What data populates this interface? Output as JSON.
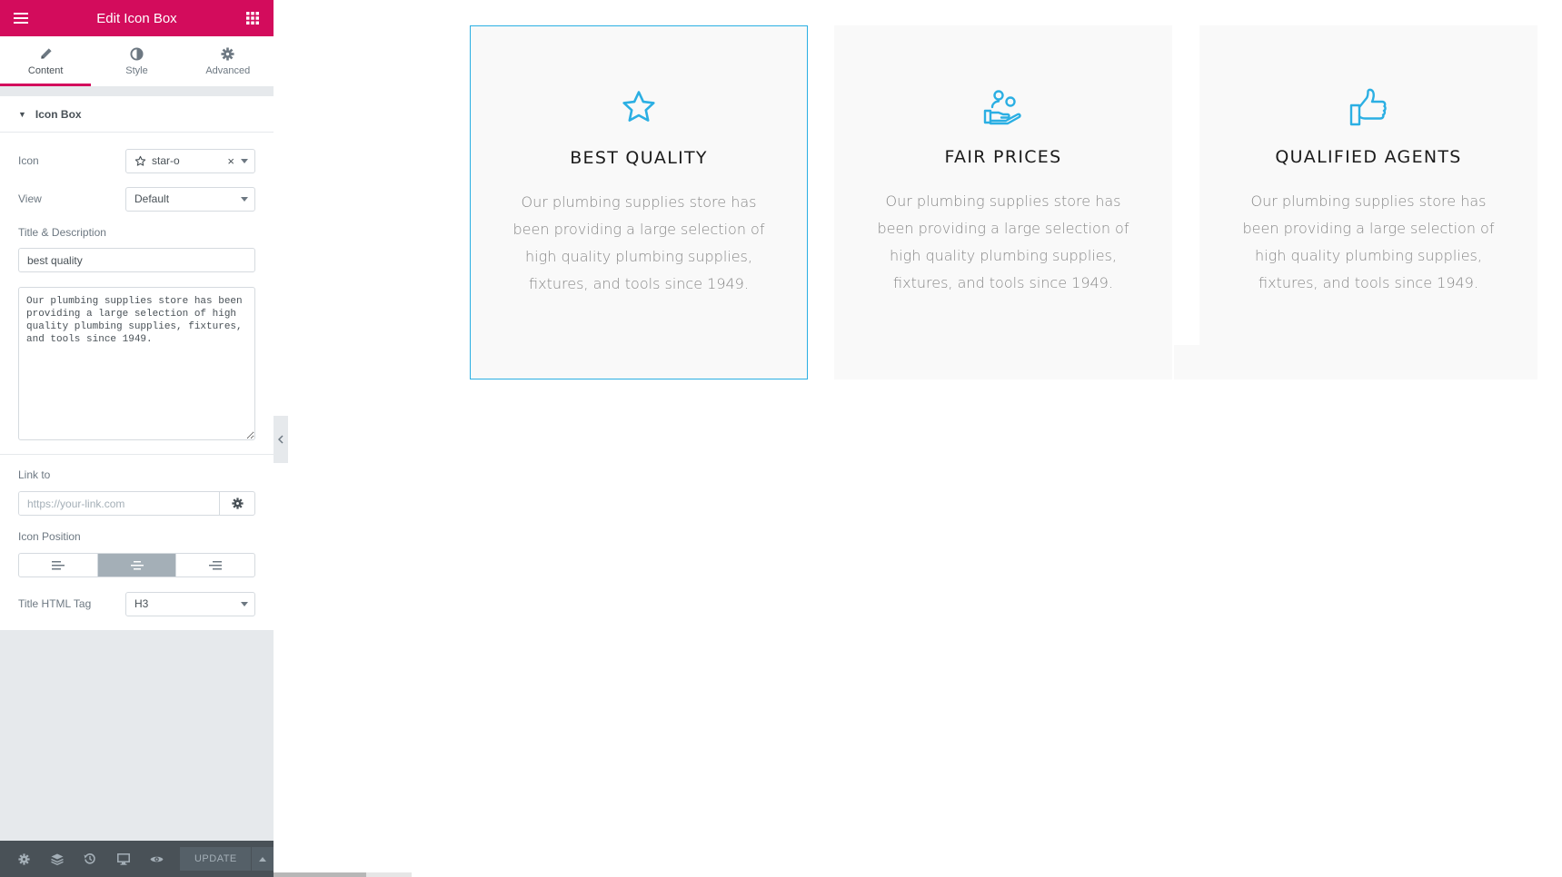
{
  "panel": {
    "title": "Edit Icon Box",
    "tabs": [
      {
        "label": "Content",
        "icon": "pencil-icon",
        "active": true
      },
      {
        "label": "Style",
        "icon": "half-circle-icon",
        "active": false
      },
      {
        "label": "Advanced",
        "icon": "gear-icon",
        "active": false
      }
    ],
    "section_title": "Icon Box",
    "icon_label": "Icon",
    "icon_value": "star-o",
    "view_label": "View",
    "view_value": "Default",
    "title_desc_label": "Title & Description",
    "title_value": "best quality",
    "description_value": "Our plumbing supplies store has been providing a large selection of high quality plumbing supplies, fixtures, and tools since 1949.",
    "link_label": "Link to",
    "link_placeholder": "https://your-link.com",
    "icon_position_label": "Icon Position",
    "icon_position_options": [
      "left",
      "top",
      "right"
    ],
    "icon_position_selected": "top",
    "title_tag_label": "Title HTML Tag",
    "title_tag_value": "H3",
    "update_label": "UPDATE",
    "accent_color": "#d30c5c"
  },
  "boxes": [
    {
      "icon": "star-outline-icon",
      "title": "BEST QUALITY",
      "description": "Our plumbing supplies store has been providing a large selection of high quality plumbing supplies, fixtures, and tools since 1949.",
      "selected": true
    },
    {
      "icon": "hand-people-icon",
      "title": "FAIR PRICES",
      "description": "Our plumbing supplies store has been providing a large selection of high quality plumbing supplies, fixtures, and tools since 1949.",
      "selected": false
    },
    {
      "icon": "thumbs-up-icon",
      "title": "QUALIFIED AGENTS",
      "description": "Our plumbing supplies store has been providing a large selection of high quality plumbing supplies, fixtures, and tools since 1949.",
      "selected": false
    }
  ],
  "colors": {
    "icon_color": "#2bafe3",
    "selection_border": "#2bafe3",
    "panel_header": "#d30c5c"
  }
}
